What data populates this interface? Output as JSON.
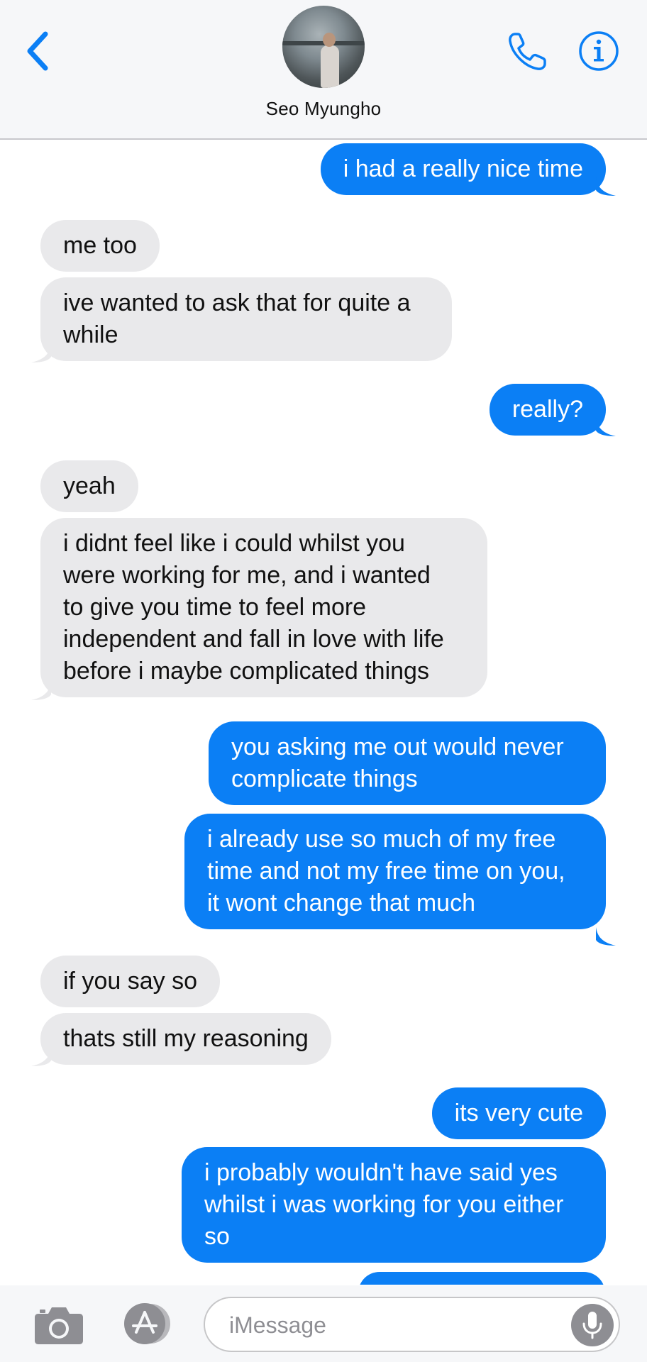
{
  "header": {
    "contact_name": "Seo Myungho"
  },
  "messages": [
    {
      "side": "out",
      "text": "i had a really nice time"
    },
    {
      "side": "in",
      "text": "me too"
    },
    {
      "side": "in",
      "text": "ive wanted to ask that for quite a\nwhile"
    },
    {
      "side": "out",
      "text": "really?"
    },
    {
      "side": "in",
      "text": "yeah"
    },
    {
      "side": "in",
      "text": "i didnt feel like i could whilst you\nwere working for me, and i wanted\nto give you time to feel more\nindependent and fall in love with life\nbefore i maybe complicated things"
    },
    {
      "side": "out",
      "text": "you asking me out would never\ncomplicate things"
    },
    {
      "side": "out",
      "text": "i already use so much of my free\ntime and not my free time on you,\nit wont change that much"
    },
    {
      "side": "in",
      "text": "if you say so"
    },
    {
      "side": "in",
      "text": "thats still my reasoning"
    },
    {
      "side": "out",
      "text": "its very cute"
    },
    {
      "side": "out",
      "text": "i probably wouldn't have said yes\nwhilst i was working for you either\nso"
    }
  ],
  "input": {
    "placeholder": "iMessage"
  },
  "colors": {
    "accent": "#0b7ff5",
    "incoming_bubble": "#e9e9eb"
  },
  "icons": [
    "chevron-left-icon",
    "phone-icon",
    "info-icon",
    "camera-icon",
    "app-store-icon",
    "microphone-icon"
  ]
}
